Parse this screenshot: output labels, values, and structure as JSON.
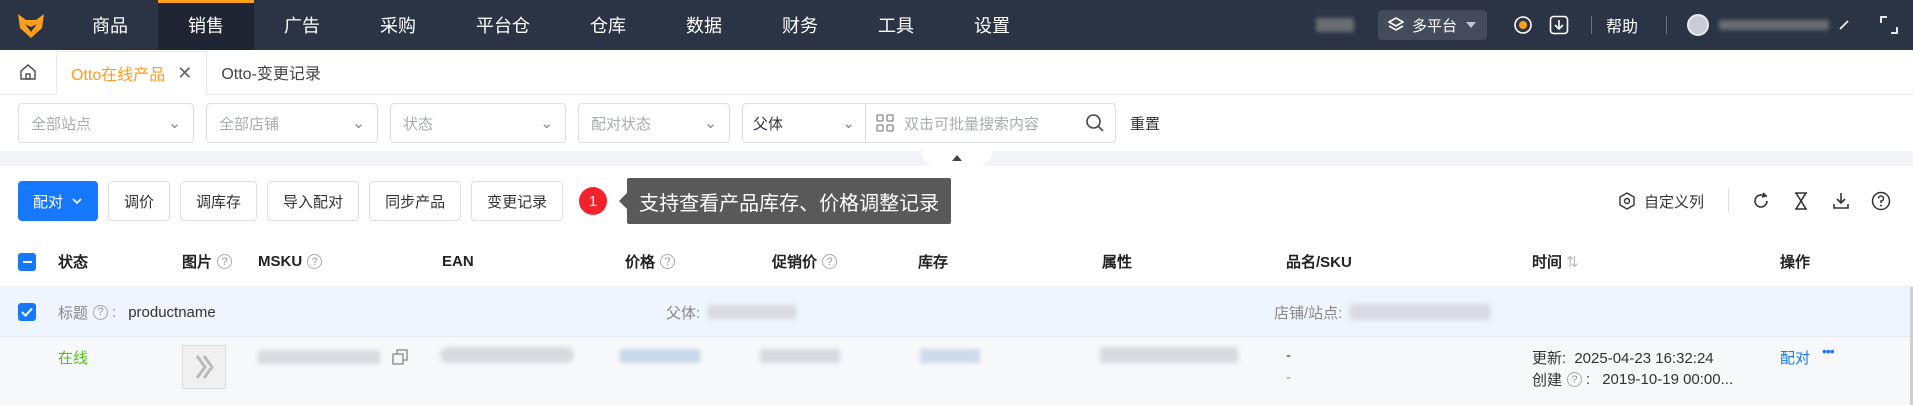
{
  "nav": {
    "items": [
      "商品",
      "销售",
      "广告",
      "采购",
      "平台仓",
      "仓库",
      "数据",
      "财务",
      "工具",
      "设置"
    ],
    "active_index": 1,
    "platform_label": "多平台",
    "help_label": "帮助",
    "accent_color": "#ff9f1a"
  },
  "tabs": [
    {
      "label": "Otto在线产品",
      "active": true
    },
    {
      "label": "Otto-变更记录",
      "active": false
    }
  ],
  "filters": {
    "site": "全部站点",
    "shop": "全部店铺",
    "status": "状态",
    "match_status": "配对状态",
    "search_type": "父体",
    "search_placeholder": "双击可批量搜索内容",
    "reset_label": "重置"
  },
  "actions": {
    "match_label": "配对",
    "adjust_price": "调价",
    "adjust_stock": "调库存",
    "import_match": "导入配对",
    "sync_products": "同步产品",
    "change_log": "变更记录",
    "badge": "1",
    "tooltip": "支持查看产品库存、价格调整记录",
    "custom_columns": "自定义列"
  },
  "table": {
    "headers": {
      "status": "状态",
      "image": "图片",
      "msku": "MSKU",
      "ean": "EAN",
      "price": "价格",
      "promo_price": "促销价",
      "stock": "库存",
      "attribute": "属性",
      "name_sku": "品名/SKU",
      "time": "时间",
      "operation": "操作"
    },
    "group": {
      "title_label": "标题",
      "title_value": "productname",
      "parent_label": "父体:",
      "shop_site_label": "店铺/站点:"
    },
    "row": {
      "status": "在线",
      "name_sku_line1": "-",
      "name_sku_line2": "-",
      "updated_label": "更新:",
      "updated_value": "2025-04-23 16:32:24",
      "created_label": "创建",
      "created_value": "2019-10-19 00:00...",
      "match_link": "配对",
      "more": "•••"
    }
  }
}
